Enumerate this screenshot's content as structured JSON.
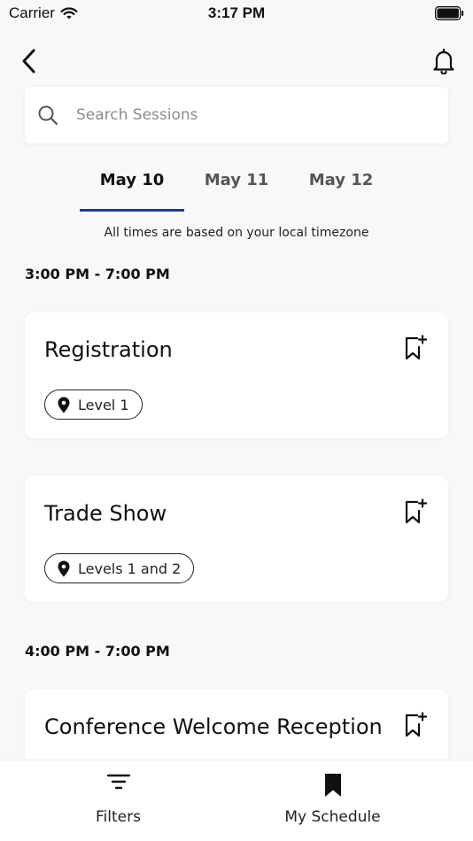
{
  "status_bar": {
    "carrier": "Carrier",
    "time": "3:17 PM"
  },
  "search": {
    "placeholder": "Search Sessions"
  },
  "tabs": [
    {
      "label": "May 10",
      "active": true
    },
    {
      "label": "May 11",
      "active": false
    },
    {
      "label": "May 12",
      "active": false
    }
  ],
  "timezone_note": "All times are based on your local timezone",
  "schedule": {
    "group_1": {
      "time": "3:00 PM - 7:00 PM",
      "sessions": [
        {
          "title": "Registration",
          "location": "Level 1"
        },
        {
          "title": "Trade Show",
          "location": "Levels 1 and 2"
        }
      ]
    },
    "group_2": {
      "time": "4:00 PM - 7:00 PM",
      "sessions": [
        {
          "title": "Conference Welcome Reception"
        }
      ]
    }
  },
  "bottom_nav": {
    "filters": {
      "label": "Filters",
      "icon": "filter-icon"
    },
    "my_schedule": {
      "label": "My Schedule",
      "icon": "bookmark-filled-icon"
    }
  },
  "colors": {
    "accent": "#1f3b8e",
    "background": "#f8f8f8",
    "card": "#ffffff"
  }
}
